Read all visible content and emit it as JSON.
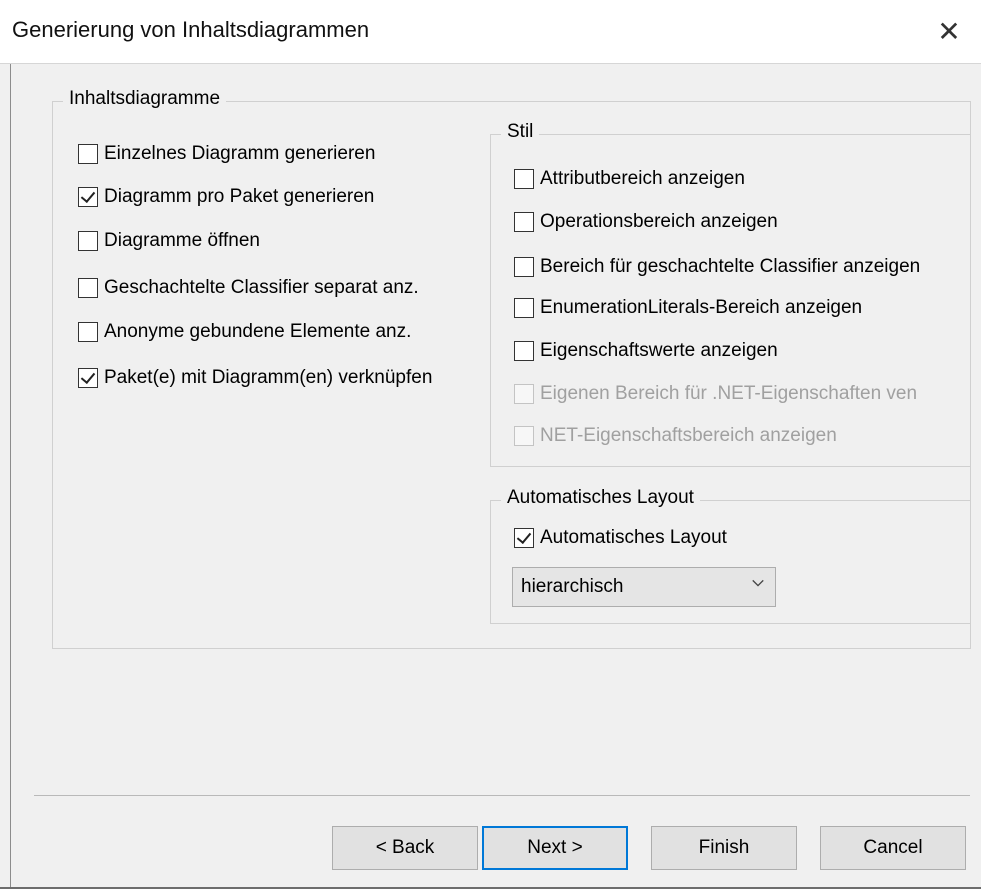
{
  "window": {
    "title": "Generierung von Inhaltsdiagrammen",
    "close_glyph": "✕"
  },
  "inhalt": {
    "legend": "Inhaltsdiagramme",
    "items": [
      {
        "label": "Einzelnes Diagramm generieren",
        "checked": false
      },
      {
        "label": "Diagramm pro Paket generieren",
        "checked": true
      },
      {
        "label": "Diagramme öffnen",
        "checked": false
      },
      {
        "label": "Geschachtelte Classifier separat anz.",
        "checked": false
      },
      {
        "label": "Anonyme gebundene Elemente anz.",
        "checked": false
      },
      {
        "label": "Paket(e) mit Diagramm(en) verknüpfen",
        "checked": true
      }
    ]
  },
  "stil": {
    "legend": "Stil",
    "items": [
      {
        "label": "Attributbereich anzeigen",
        "checked": false,
        "enabled": true
      },
      {
        "label": "Operationsbereich anzeigen",
        "checked": false,
        "enabled": true
      },
      {
        "label": "Bereich für geschachtelte Classifier anzeigen",
        "checked": false,
        "enabled": true
      },
      {
        "label": "EnumerationLiterals-Bereich anzeigen",
        "checked": false,
        "enabled": true
      },
      {
        "label": "Eigenschaftswerte anzeigen",
        "checked": false,
        "enabled": true
      },
      {
        "label": "Eigenen Bereich für .NET-Eigenschaften ven",
        "checked": false,
        "enabled": false
      },
      {
        "label": "NET-Eigenschaftsbereich anzeigen",
        "checked": false,
        "enabled": false
      }
    ]
  },
  "layout": {
    "legend": "Automatisches Layout",
    "checkbox_label": "Automatisches Layout",
    "checked": true,
    "select_value": "hierarchisch"
  },
  "buttons": {
    "back": "< Back",
    "next": "Next >",
    "finish": "Finish",
    "cancel": "Cancel"
  },
  "colors": {
    "accent": "#0078d7",
    "background": "#f0f0f0"
  }
}
